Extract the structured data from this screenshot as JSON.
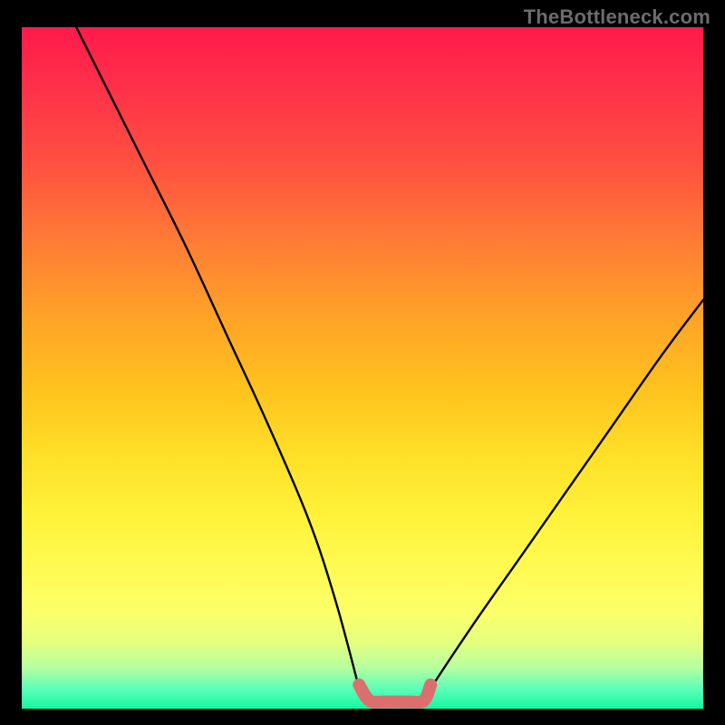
{
  "watermark": {
    "text": "TheBottleneck.com"
  },
  "chart_data": {
    "type": "line",
    "title": "",
    "xlabel": "",
    "ylabel": "",
    "xlim": [
      0,
      100
    ],
    "ylim": [
      0,
      100
    ],
    "grid": false,
    "series": [
      {
        "name": "left-curve",
        "color": "#000000",
        "x": [
          8,
          12,
          18,
          24,
          30,
          36,
          42,
          46,
          49.5
        ],
        "y": [
          100,
          92,
          80,
          68,
          55,
          42,
          28,
          16,
          3
        ]
      },
      {
        "name": "right-curve",
        "color": "#000000",
        "x": [
          60,
          66,
          73,
          80,
          87,
          94,
          100
        ],
        "y": [
          3,
          12,
          22,
          32,
          42,
          52,
          60
        ]
      },
      {
        "name": "flat-pink-segment",
        "color": "#dd6e6e",
        "x": [
          49.5,
          51,
          53,
          55,
          57,
          59,
          60
        ],
        "y": [
          3.5,
          1.2,
          1.0,
          1.0,
          1.0,
          1.2,
          3.5
        ]
      }
    ],
    "markers": [
      {
        "x": 49.5,
        "y": 3.5,
        "color": "#dd6e6e",
        "r": 6
      },
      {
        "x": 60.0,
        "y": 3.5,
        "color": "#dd6e6e",
        "r": 6
      }
    ],
    "gradient_bands": [
      {
        "y": 0,
        "color": "#ff1a4b"
      },
      {
        "y": 50,
        "color": "#ffd028"
      },
      {
        "y": 85,
        "color": "#fcff6a"
      },
      {
        "y": 100,
        "color": "#13f8a0"
      }
    ]
  }
}
